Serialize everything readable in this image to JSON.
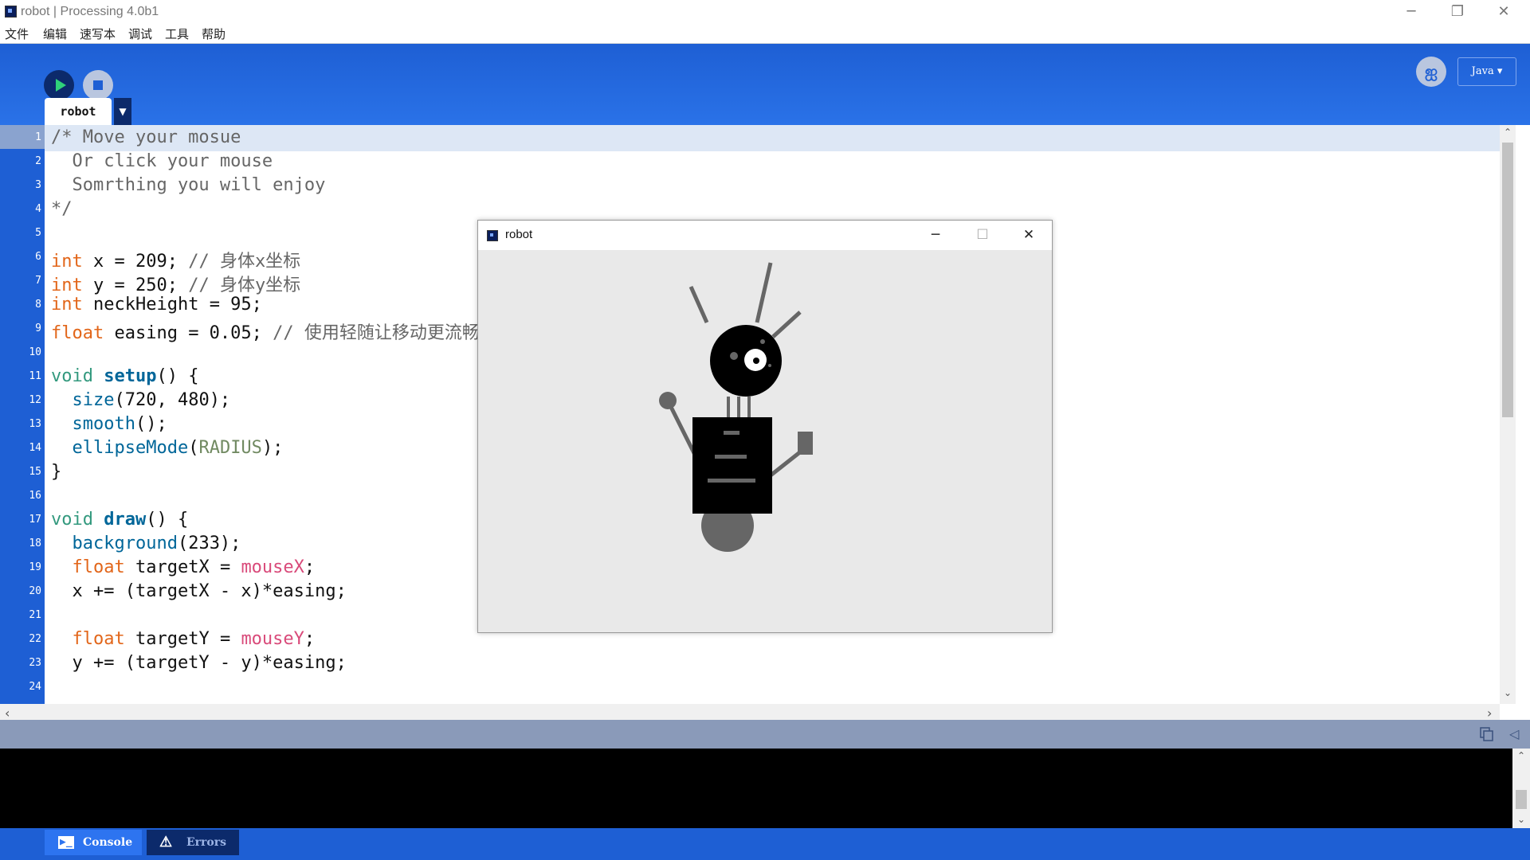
{
  "window": {
    "title": "robot | Processing 4.0b1",
    "minimize": "─",
    "maximize": "❐",
    "close": "✕"
  },
  "menu": [
    "文件",
    "编辑",
    "速写本",
    "调试",
    "工具",
    "帮助"
  ],
  "toolbar": {
    "run_icon": "play-icon",
    "stop_icon": "stop-icon",
    "debug_icon": "butterfly-icon",
    "debug_glyph": "ஐ",
    "mode": "Java ▾"
  },
  "tabs": [
    {
      "label": "robot",
      "menu": "▼"
    }
  ],
  "code": {
    "line_numbers": [
      "1",
      "2",
      "3",
      "4",
      "5",
      "6",
      "7",
      "8",
      "9",
      "10",
      "11",
      "12",
      "13",
      "14",
      "15",
      "16",
      "17",
      "18",
      "19",
      "20",
      "21",
      "22",
      "23",
      "24"
    ],
    "current_line": 1
  },
  "scroll": {
    "up": "⌃",
    "down": "⌄",
    "left": "‹",
    "right": "›"
  },
  "status": {
    "copy_icon": "copy-icon",
    "collapse": "◁"
  },
  "footer": {
    "console": "Console",
    "errors": "Errors",
    "console_glyph": "▶_",
    "errors_glyph": "⚠"
  },
  "sketch_window": {
    "title": "robot",
    "minimize": "─",
    "maximize": "☐",
    "close": "✕",
    "background": "#e9e9e9"
  }
}
